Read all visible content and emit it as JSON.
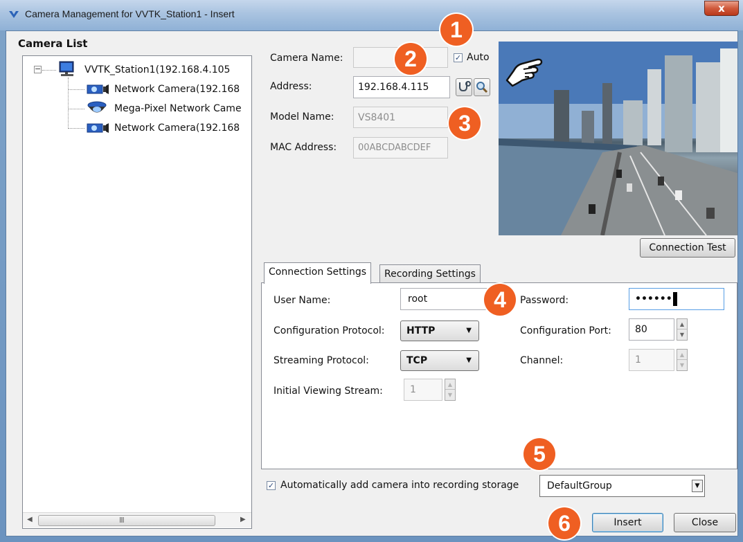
{
  "window": {
    "title": "Camera Management for VVTK_Station1 - Insert",
    "close_label": "x"
  },
  "camera_list": {
    "title": "Camera List",
    "root": "VVTK_Station1(192.168.4.105",
    "items": [
      {
        "label": "Network Camera(192.168",
        "icon": "network-camera-icon"
      },
      {
        "label": "Mega-Pixel Network Came",
        "icon": "dome-camera-icon"
      },
      {
        "label": "Network Camera(192.168",
        "icon": "network-camera-icon"
      }
    ],
    "scroll_grip": "III"
  },
  "form": {
    "camera_name_label": "Camera Name:",
    "camera_name_value": "",
    "auto_label": "Auto",
    "auto_checked": true,
    "address_label": "Address:",
    "address_value": "192.168.4.115",
    "model_name_label": "Model Name:",
    "model_name_value": "VS8401",
    "mac_label": "MAC Address:",
    "mac_value": "00ABCDABCDEF"
  },
  "connection_test_label": "Connection Test",
  "tabs": [
    {
      "label": "Connection Settings",
      "active": true
    },
    {
      "label": "Recording Settings",
      "active": false
    }
  ],
  "connection": {
    "user_name_label": "User Name:",
    "user_name_value": "root",
    "password_label": "Password:",
    "password_value": "••••••",
    "config_protocol_label": "Configuration Protocol:",
    "config_protocol_value": "HTTP",
    "config_port_label": "Configuration Port:",
    "config_port_value": "80",
    "streaming_protocol_label": "Streaming Protocol:",
    "streaming_protocol_value": "TCP",
    "channel_label": "Channel:",
    "channel_value": "1",
    "initial_stream_label": "Initial Viewing Stream:",
    "initial_stream_value": "1"
  },
  "footer": {
    "auto_add_label": "Automatically add camera into recording storage",
    "auto_add_checked": true,
    "group_value": "DefaultGroup",
    "insert_label": "Insert",
    "close_label": "Close"
  },
  "callouts": [
    "1",
    "2",
    "3",
    "4",
    "5",
    "6"
  ],
  "colors": {
    "callout": "#ef5f22",
    "titlebar": "#a9c3e0"
  }
}
